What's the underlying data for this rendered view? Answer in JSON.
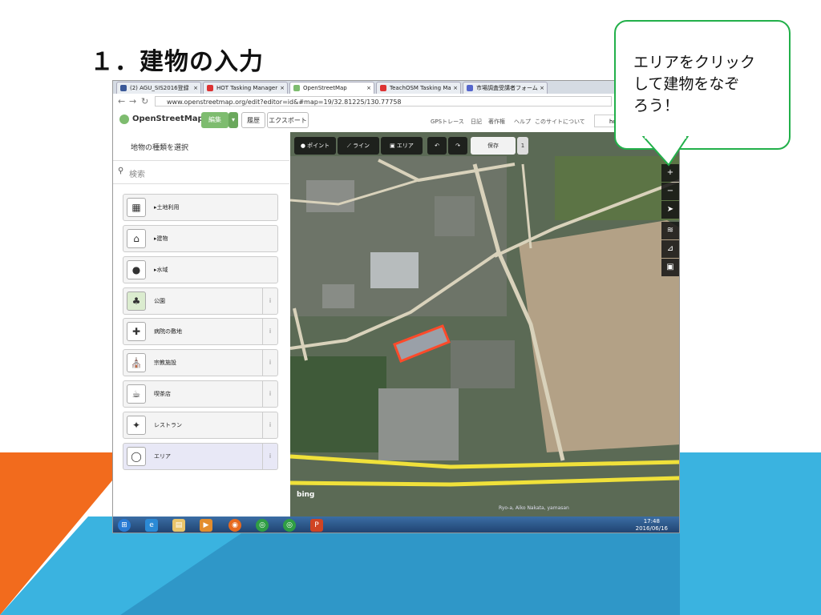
{
  "slide": {
    "title": "１．建物の入力",
    "callout": [
      "エリアをクリック",
      "して建物をなぞ",
      "ろう！"
    ]
  },
  "browser": {
    "tabs": [
      {
        "label": "(2) AGU_SIS2016登録",
        "fav": "#3b5998"
      },
      {
        "label": "HOT Tasking Manager",
        "fav": "#d33"
      },
      {
        "label": "OpenStreetMap",
        "fav": "#7ebc6f",
        "active": true
      },
      {
        "label": "TeachOSM Tasking Ma",
        "fav": "#d33"
      },
      {
        "label": "市場調査受講者フォーム",
        "fav": "#5566cc"
      }
    ],
    "url": "www.openstreetmap.org/edit?editor=id&#map=19/32.81225/130.77758"
  },
  "osm": {
    "logo": "OpenStreetMap",
    "edit": "編集",
    "history": "履歴",
    "export": "エクスポート",
    "links": [
      "GPSトレース",
      "日記",
      "著作権",
      "ヘルプ",
      "このサイトについて"
    ],
    "user": "ho"
  },
  "sidebar": {
    "title": "地物の種類を選択",
    "search_placeholder": "検索",
    "presets": [
      {
        "label": "▸土地利用",
        "icon": "landuse-icon",
        "glyph": "▦",
        "info": false
      },
      {
        "label": "▸建物",
        "icon": "building-icon",
        "glyph": "⌂",
        "info": false
      },
      {
        "label": "▸水域",
        "icon": "water-icon",
        "glyph": "●",
        "info": false
      },
      {
        "label": "公園",
        "icon": "tree-icon",
        "glyph": "♣",
        "info": true
      },
      {
        "label": "病院の敷地",
        "icon": "hospital-icon",
        "glyph": "✚",
        "info": true
      },
      {
        "label": "宗教施設",
        "icon": "religious-icon",
        "glyph": "⛪",
        "info": true
      },
      {
        "label": "喫茶店",
        "icon": "cafe-icon",
        "glyph": "☕",
        "info": true
      },
      {
        "label": "レストラン",
        "icon": "restaurant-icon",
        "glyph": "✦",
        "info": true
      },
      {
        "label": "エリア",
        "icon": "area-icon",
        "glyph": "◯",
        "info": true,
        "selected": true
      }
    ]
  },
  "map": {
    "tools": {
      "point": "ポイント",
      "line": "ライン",
      "area": "エリア",
      "save": "保存",
      "count": "1"
    },
    "bing": "bing",
    "attribution": "Ryo-a, Aiko Nakata, yamasan"
  },
  "taskbar": {
    "time": "17:48",
    "date": "2016/06/16"
  }
}
